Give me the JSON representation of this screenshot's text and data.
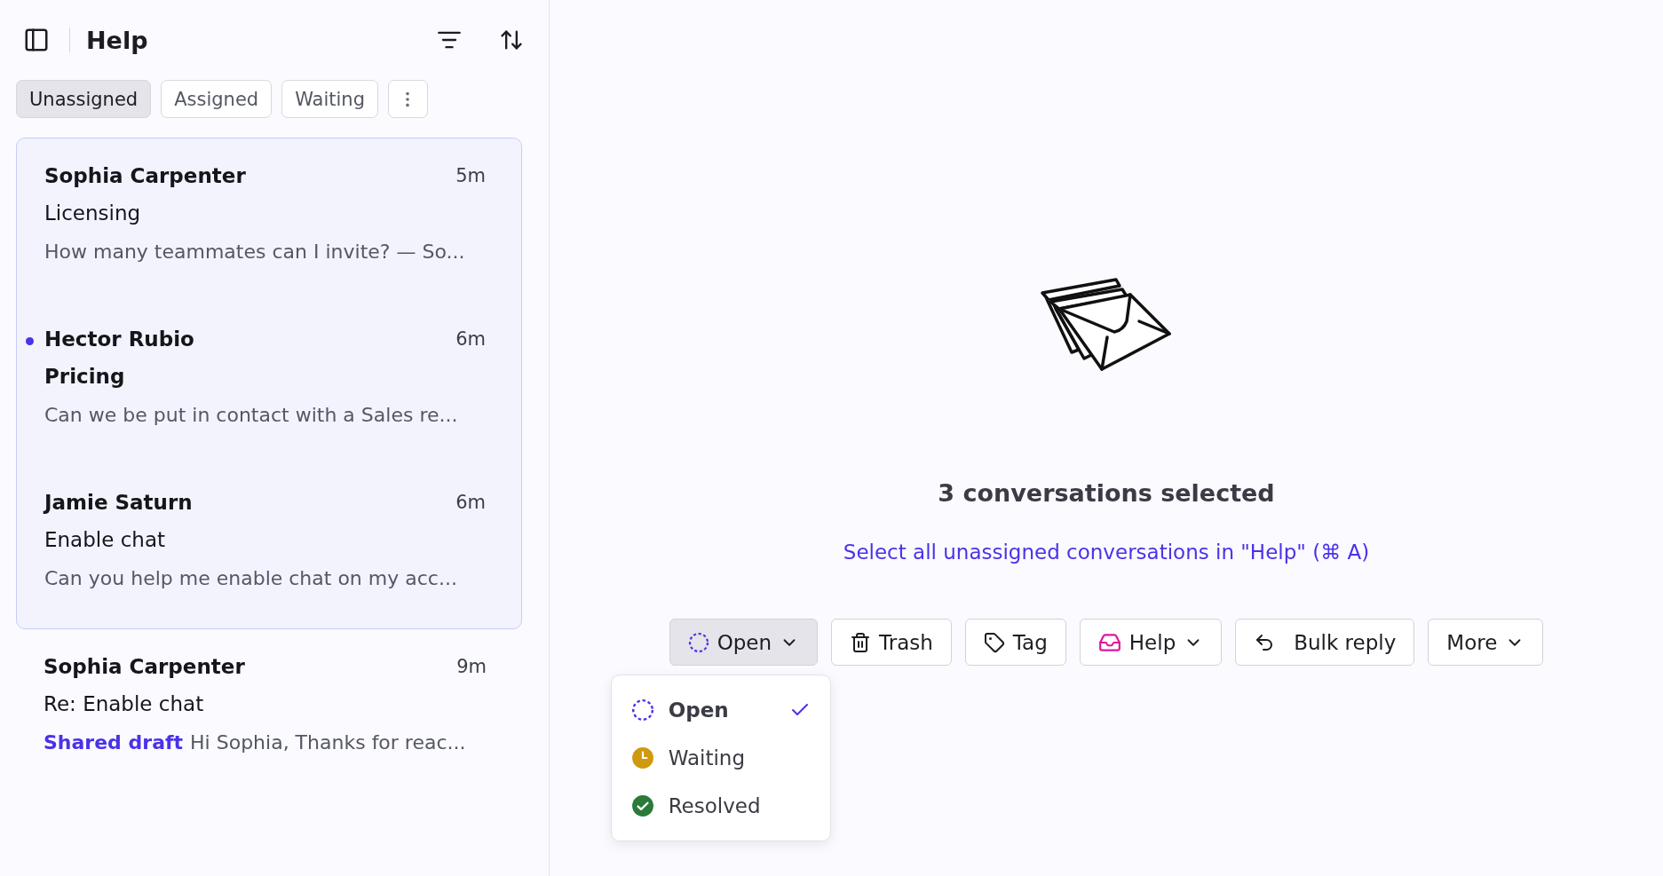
{
  "sidebar": {
    "title": "Help",
    "tabs": [
      {
        "label": "Unassigned",
        "selected": true
      },
      {
        "label": "Assigned",
        "selected": false
      },
      {
        "label": "Waiting",
        "selected": false
      }
    ],
    "conversations": [
      {
        "name": "Sophia Carpenter",
        "time": "5m",
        "subject": "Licensing",
        "preview": "How many teammates can I invite? — So...",
        "selected": true,
        "unread": false
      },
      {
        "name": "Hector Rubio",
        "time": "6m",
        "subject": "Pricing",
        "preview": "Can we be put in contact with a Sales re...",
        "selected": true,
        "unread": true
      },
      {
        "name": "Jamie Saturn",
        "time": "6m",
        "subject": "Enable chat",
        "preview": "Can you help me enable chat on my acc...",
        "selected": true,
        "unread": false
      },
      {
        "name": "Sophia Carpenter",
        "time": "9m",
        "subject": "Re: Enable chat",
        "draft_label": "Shared draft",
        "preview": "Hi Sophia, Thanks for reac...",
        "selected": false,
        "unread": false
      }
    ]
  },
  "main": {
    "heading": "3 conversations selected",
    "select_all_link": "Select all unassigned conversations in \"Help\" (⌘ A)",
    "actions": [
      {
        "label": "Open",
        "dropdown": true,
        "expanded": true
      },
      {
        "label": "Trash",
        "dropdown": false,
        "expanded": false
      },
      {
        "label": "Tag",
        "dropdown": false,
        "expanded": false
      },
      {
        "label": "Help",
        "dropdown": true,
        "expanded": false
      },
      {
        "label": "Bulk reply",
        "dropdown": false,
        "expanded": false
      },
      {
        "label": "More",
        "dropdown": true,
        "expanded": false
      }
    ],
    "status_menu": [
      {
        "label": "Open",
        "selected": true
      },
      {
        "label": "Waiting",
        "selected": false
      },
      {
        "label": "Resolved",
        "selected": false
      }
    ]
  }
}
